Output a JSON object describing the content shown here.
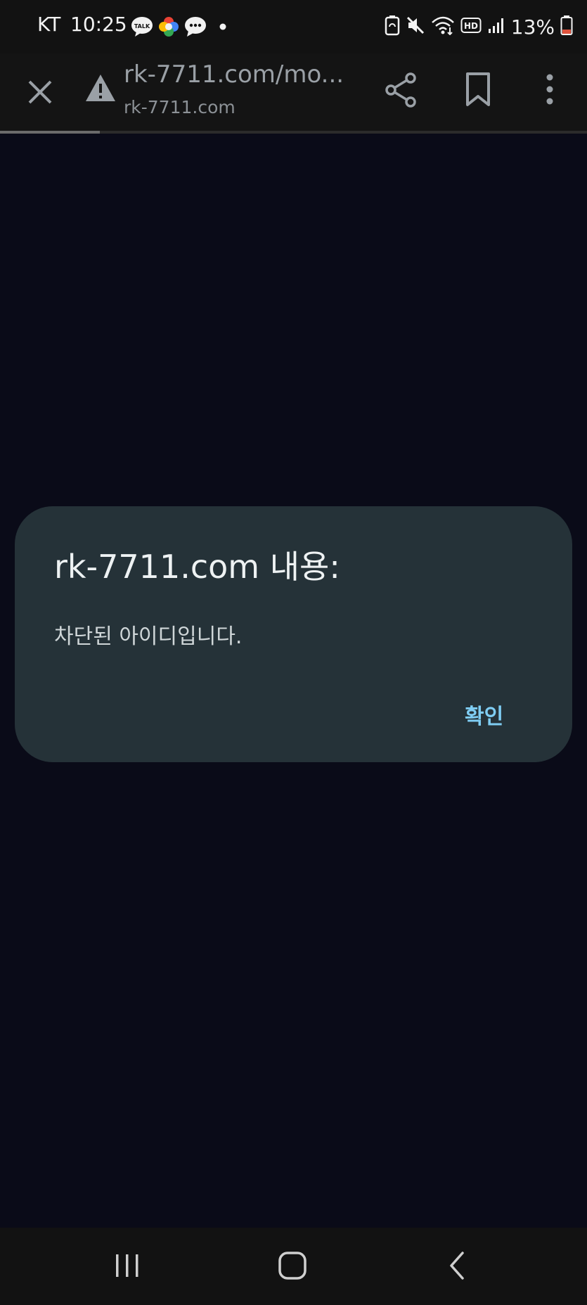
{
  "status_bar": {
    "carrier": "KT",
    "time": "10:25",
    "battery_percent": "13%",
    "notification_icons": [
      "kakaotalk-icon",
      "photos-icon",
      "messages-icon",
      "dot-icon"
    ],
    "system_icons": [
      "battery-saver-icon",
      "mute-icon",
      "wifi-icon",
      "hd-icon",
      "signal-icon",
      "battery-icon"
    ]
  },
  "toolbar": {
    "url_title": "rk-7711.com/mo...",
    "url_host": "rk-7711.com",
    "icons": [
      "close-icon",
      "warning-icon",
      "share-icon",
      "bookmark-icon",
      "more-vert-icon"
    ],
    "progress_fraction": 0.17
  },
  "dialog": {
    "title": "rk-7711.com 내용:",
    "message": "차단된 아이디입니다.",
    "ok_label": "확인"
  },
  "nav_bar": {
    "icons": [
      "recents-icon",
      "home-icon",
      "back-icon"
    ]
  },
  "colors": {
    "page_background": "#0a0b18",
    "dialog_background": "#253238",
    "accent": "#7fcdf3"
  }
}
